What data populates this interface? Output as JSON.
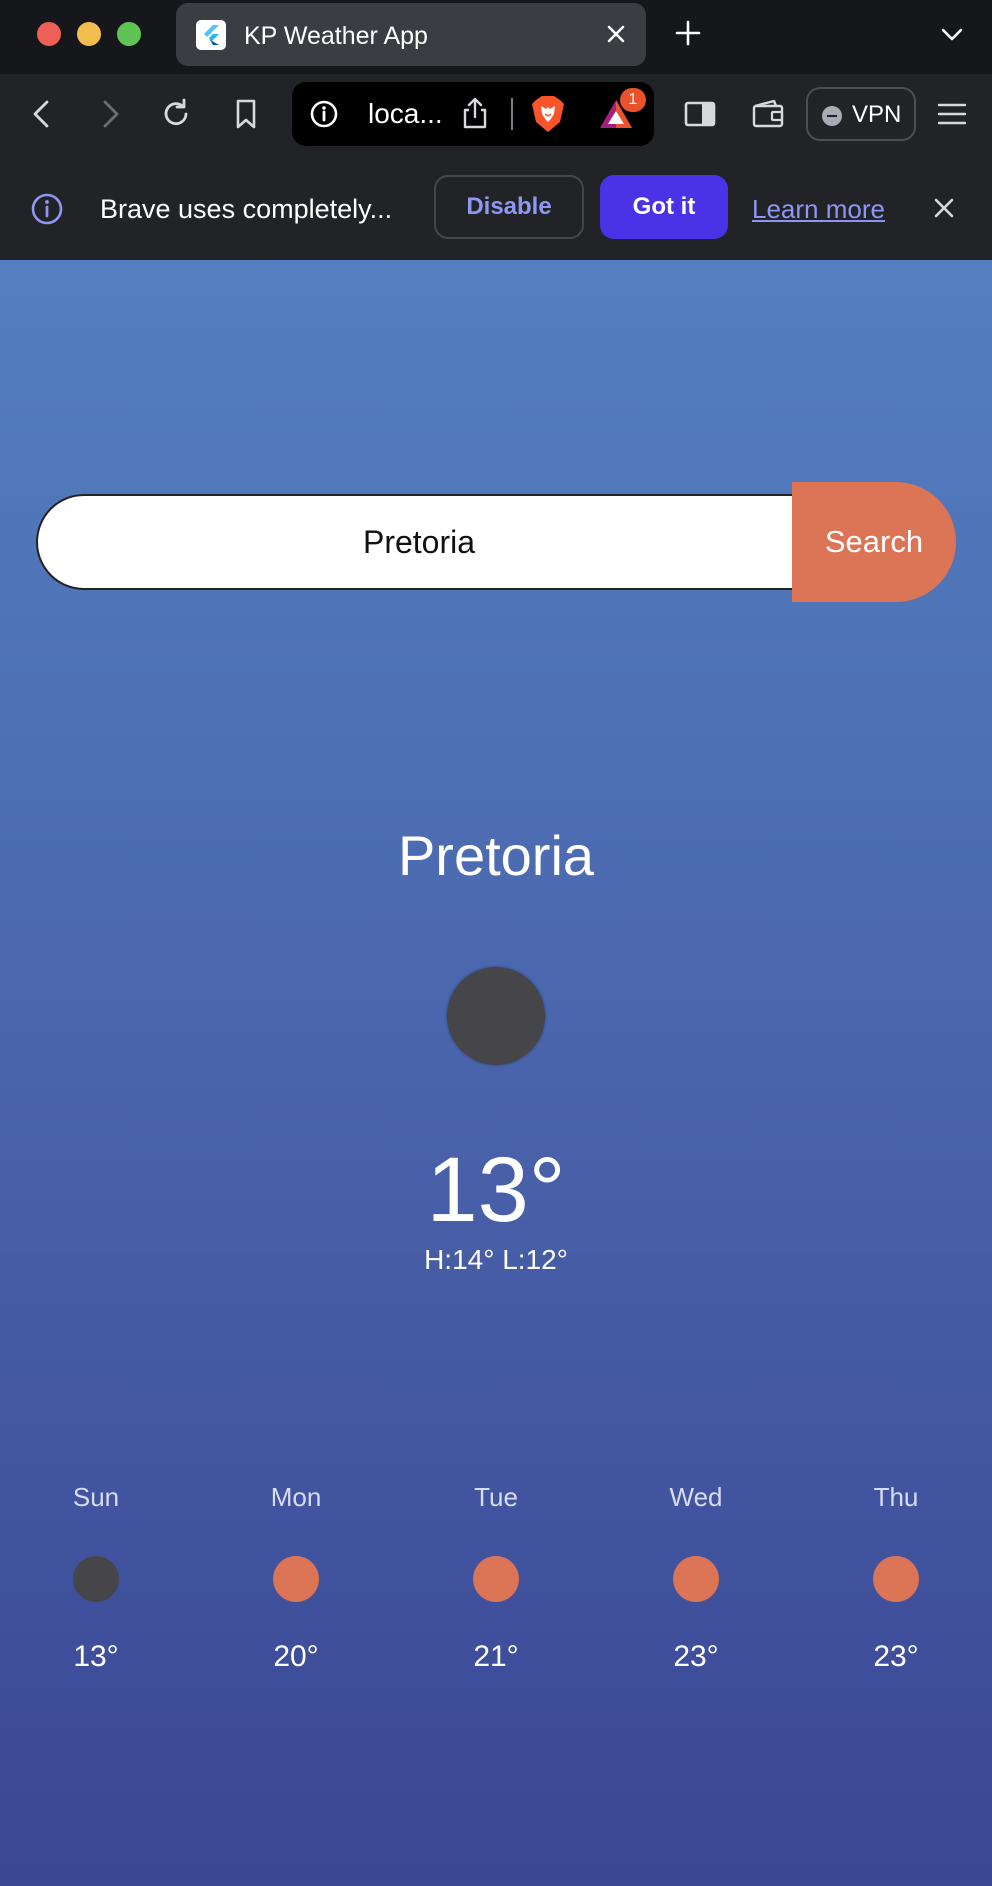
{
  "browser": {
    "tab": {
      "title": "KP Weather App"
    },
    "url": "loca...",
    "rewards_badge": "1",
    "vpn_label": "VPN"
  },
  "infobar": {
    "message": "Brave uses completely...",
    "disable_label": "Disable",
    "gotit_label": "Got it",
    "learn_more_label": "Learn more"
  },
  "app": {
    "search": {
      "value": "Pretoria",
      "button_label": "Search"
    },
    "current": {
      "city": "Pretoria",
      "temp": "13°",
      "hilo": "H:14° L:12°",
      "icon_color": "#46464a"
    },
    "forecast": [
      {
        "day": "Sun",
        "temp": "13°",
        "icon_color": "#46464a"
      },
      {
        "day": "Mon",
        "temp": "20°",
        "icon_color": "#dc7456"
      },
      {
        "day": "Tue",
        "temp": "21°",
        "icon_color": "#dc7456"
      },
      {
        "day": "Wed",
        "temp": "23°",
        "icon_color": "#dc7456"
      },
      {
        "day": "Thu",
        "temp": "23°",
        "icon_color": "#dc7456"
      }
    ]
  },
  "colors": {
    "accent": "#dc7456",
    "brave_primary": "#4a33e6",
    "gradient_top": "#537fc1",
    "gradient_bottom": "#3b4694"
  }
}
